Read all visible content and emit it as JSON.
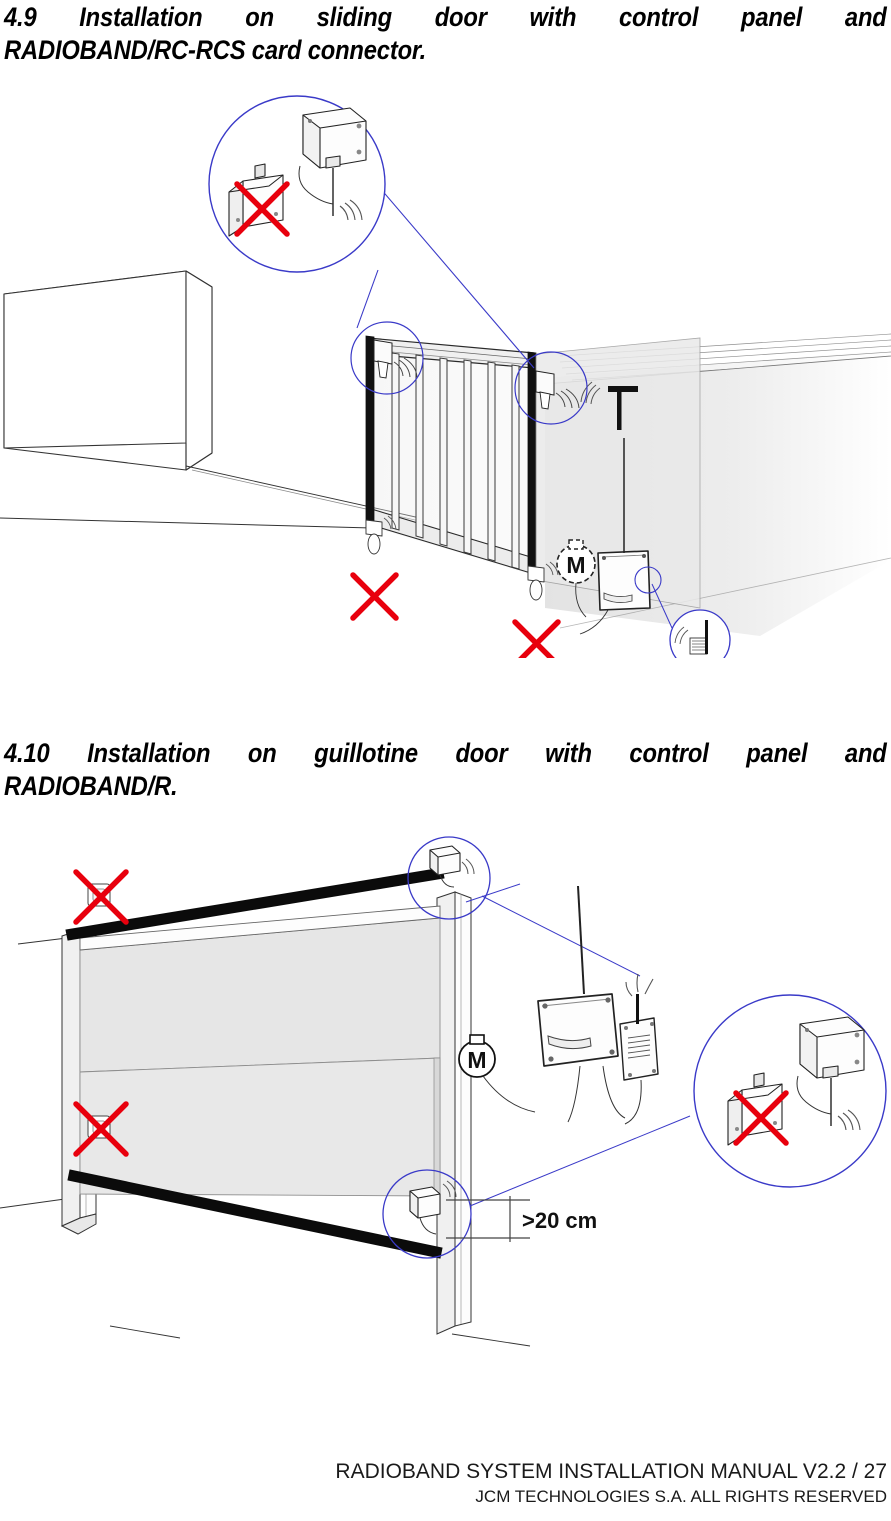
{
  "document": {
    "type": "technical-installation-manual-page",
    "page_background": "#ffffff"
  },
  "sections": [
    {
      "number": "4.9",
      "line1": "4.9     Installation     on     sliding     door     with     control     panel     and",
      "line2": "RADIOBAND/RC-RCS card connector.",
      "full_title": "4.9 Installation on sliding door with control panel and RADIOBAND/RC-RCS card connector."
    },
    {
      "number": "4.10",
      "line1": "4.10   Installation   on   guillotine   door   with   control   panel   and",
      "line2": "RADIOBAND/R.",
      "full_title": "4.10 Installation on guillotine door with control panel and RADIOBAND/R."
    }
  ],
  "figures": {
    "sliding": {
      "name": "sliding-door-installation-diagram",
      "elements": {
        "wall_block": "perimeter-wall",
        "gate": "sliding-gate-with-vertical-bars",
        "motor_label": "M",
        "control_panel": "control-panel-with-antenna",
        "correct_markers": 2,
        "forbidden_markers": 2
      },
      "callouts": [
        {
          "name": "transmitter-detail-callout",
          "content": "radioband-transmitter-correct-vs-incorrect"
        },
        {
          "name": "sensor-top-left-callout",
          "content": "sensor-on-leading-edge-top"
        },
        {
          "name": "sensor-top-right-callout",
          "content": "sensor-on-leading-edge-top"
        },
        {
          "name": "card-connector-callout",
          "content": "rc-rcs-card-connector-with-antenna"
        }
      ]
    },
    "guillotine": {
      "name": "guillotine-door-installation-diagram",
      "elements": {
        "door_panels": 2,
        "safety_edges": 2,
        "motor_label": "M",
        "control_panel": "control-panel-with-antenna",
        "receiver_module": "radioband-r-receiver",
        "correct_markers": 3,
        "forbidden_markers": 2
      },
      "dimension_label": ">20 cm",
      "callouts": [
        {
          "name": "top-edge-transmitter-callout",
          "content": "transmitter-on-top-safety-edge"
        },
        {
          "name": "bottom-edge-transmitter-callout",
          "content": "transmitter-on-bottom-safety-edge"
        },
        {
          "name": "transmitter-detail-callout",
          "content": "radioband-transmitter-correct-vs-incorrect"
        }
      ]
    }
  },
  "footer": {
    "line1": "RADIOBAND SYSTEM INSTALLATION MANUAL V2.2 / 27",
    "line2": "JCM TECHNOLOGIES S.A. ALL RIGHTS RESERVED",
    "manual_name": "RADIOBAND SYSTEM INSTALLATION MANUAL",
    "version": "V2.2",
    "page_number": "27",
    "company": "JCM TECHNOLOGIES S.A."
  },
  "colors": {
    "callout_blue": "#3a3ac8",
    "forbidden_red": "#e8000d",
    "line_black": "#1a1a1a",
    "panel_fill": "#e6e6e6",
    "text": "#000000"
  }
}
